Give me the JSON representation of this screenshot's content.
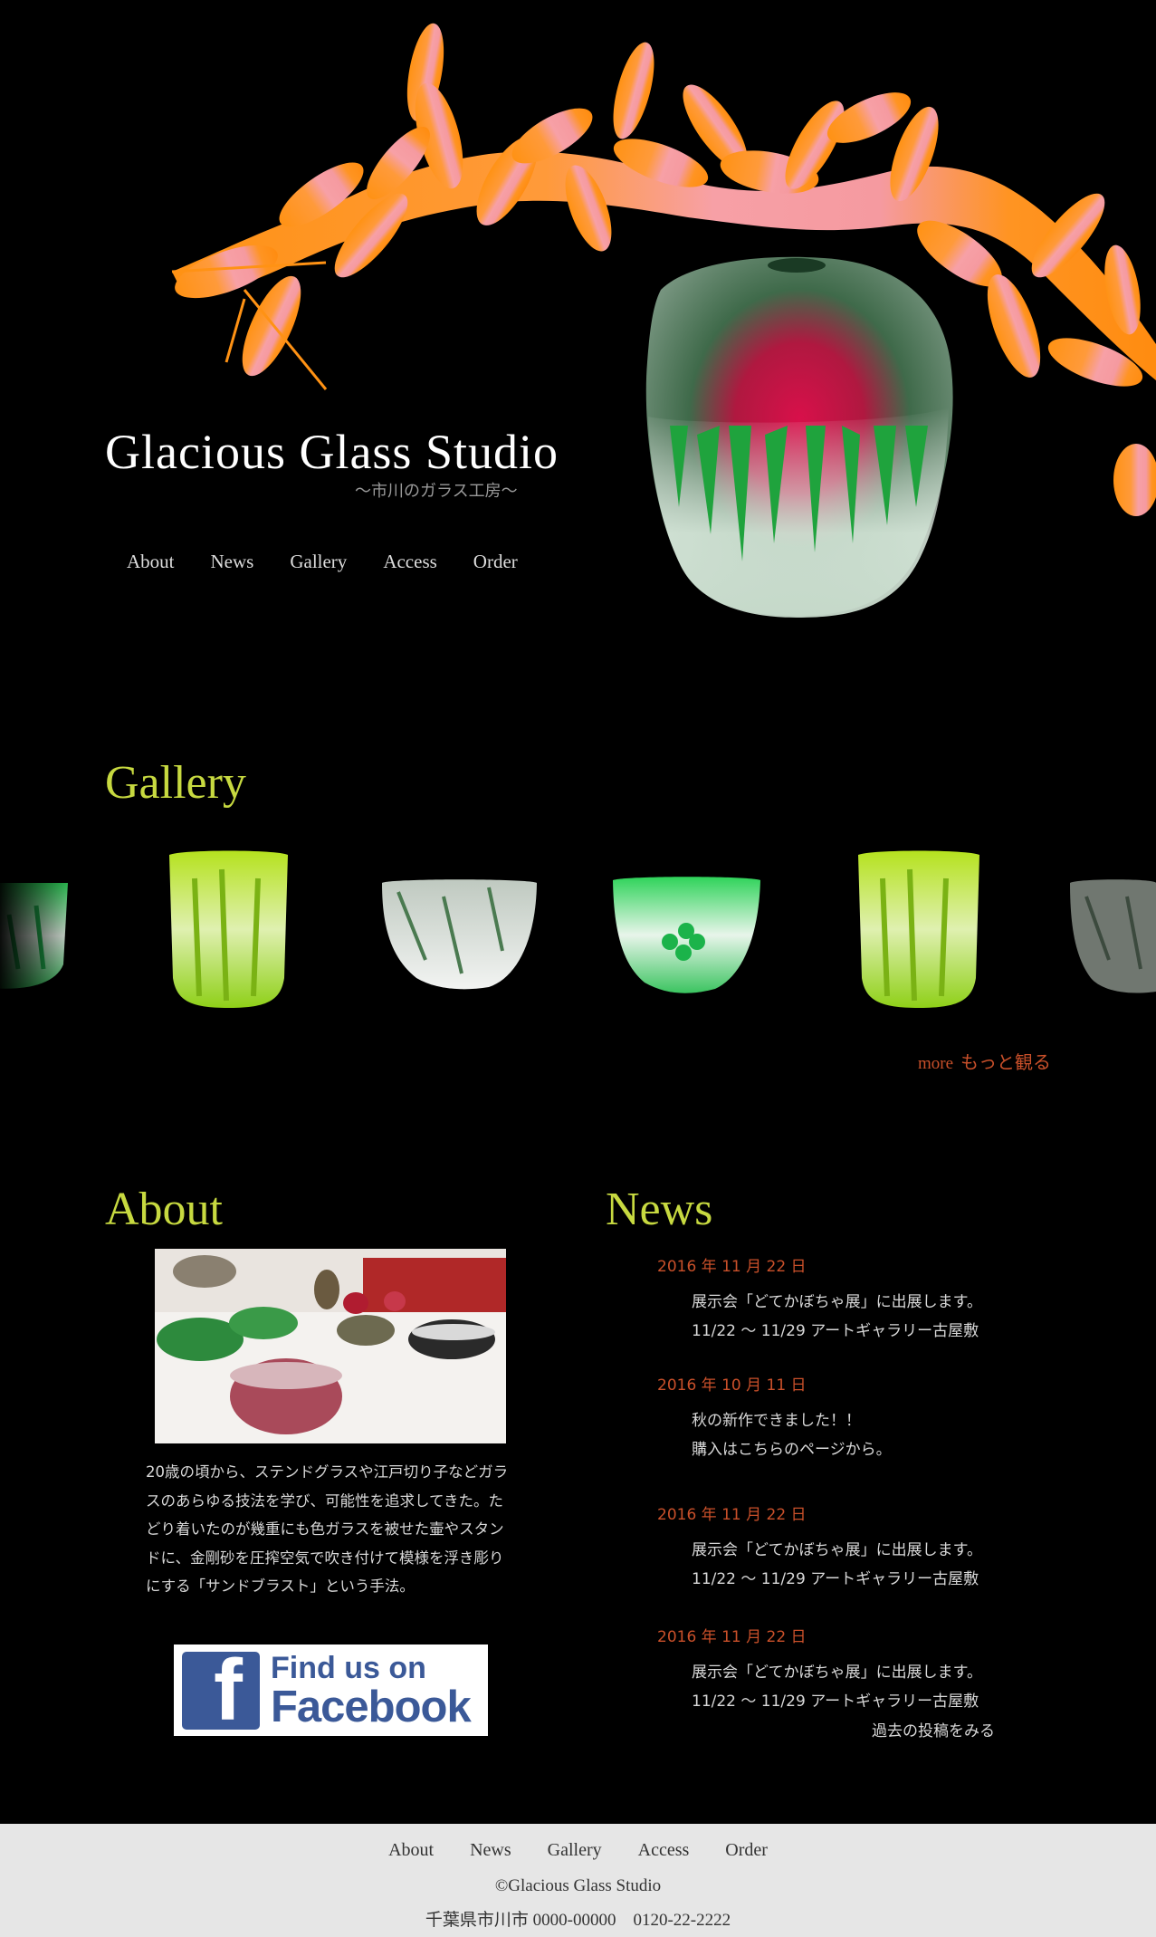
{
  "header": {
    "title": "Glacious Glass Studio",
    "subtitle": "〜市川のガラス工房〜",
    "nav": [
      "About",
      "News",
      "Gallery",
      "Access",
      "Order"
    ]
  },
  "gallery": {
    "heading": "Gallery",
    "more_en": "more",
    "more_jp": "もっと観る"
  },
  "about": {
    "heading": "About",
    "text": "20歳の頃から、ステンドグラスや江戸切り子などガラスのあらゆる技法を学び、可能性を追求してきた。たどり着いたのが幾重にも色ガラスを被せた壷やスタンドに、金剛砂を圧搾空気で吹き付けて模様を浮き彫りにする「サンドブラスト」という手法。",
    "facebook_line1": "Find us on",
    "facebook_line2": "Facebook"
  },
  "news": {
    "heading": "News",
    "items": [
      {
        "date": "2016 年 11 月 22 日",
        "line1": "展示会「どてかぼちゃ展」に出展します。",
        "line2": "11/22 〜 11/29 アートギャラリー古屋敷"
      },
      {
        "date": "2016 年 10 月 11 日",
        "line1": "秋の新作できました！！",
        "line2": "購入はこちらのページから。"
      },
      {
        "date": "2016 年 11 月 22 日",
        "line1": "展示会「どてかぼちゃ展」に出展します。",
        "line2": "11/22 〜 11/29 アートギャラリー古屋敷"
      },
      {
        "date": "2016 年 11 月 22 日",
        "line1": "展示会「どてかぼちゃ展」に出展します。",
        "line2": "11/22 〜 11/29 アートギャラリー古屋敷"
      }
    ],
    "past_link": "過去の投稿をみる"
  },
  "footer": {
    "nav": [
      "About",
      "News",
      "Gallery",
      "Access",
      "Order"
    ],
    "copyright": "©Glacious Glass Studio",
    "address": "千葉県市川市 0000-00000　0120-22-2222"
  },
  "colors": {
    "background": "#000000",
    "heading_green": "#c7d940",
    "accent_orange": "#c9502a",
    "footer_bg": "#e6e6e6",
    "facebook_blue": "#3b5998"
  }
}
